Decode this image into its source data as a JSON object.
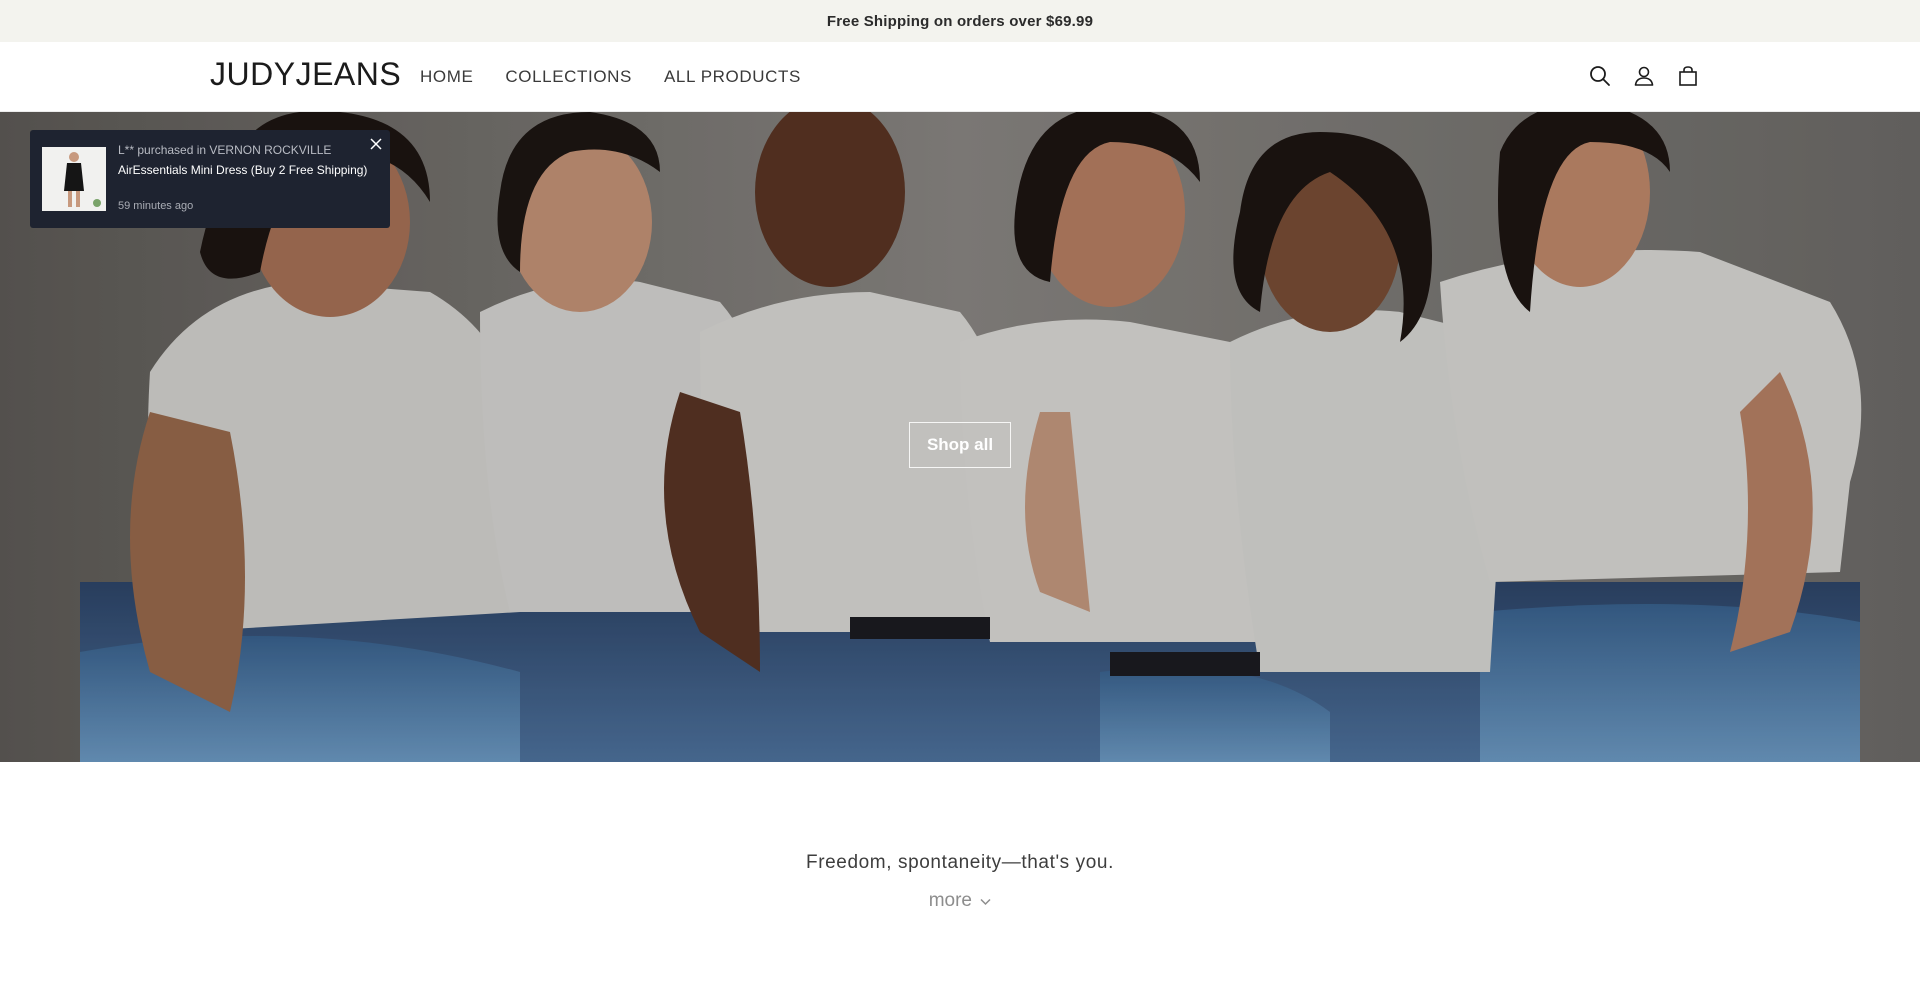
{
  "announcement": {
    "text": "Free Shipping on orders over $69.99"
  },
  "header": {
    "logo": "JUDYJEANS",
    "nav": [
      {
        "label": "HOME"
      },
      {
        "label": "COLLECTIONS"
      },
      {
        "label": "ALL PRODUCTS"
      }
    ],
    "icons": [
      "search-icon",
      "account-icon",
      "cart-icon"
    ]
  },
  "hero": {
    "button_label": "Shop all"
  },
  "toast": {
    "line1": "L** purchased in VERNON ROCKVILLE",
    "product": "AirEssentials Mini Dress (Buy 2 Free Shipping)",
    "time": "59 minutes ago"
  },
  "intro": {
    "tagline": "Freedom, spontaneity—that's you.",
    "more_label": "more"
  },
  "colors": {
    "announcement_bg": "#f3f3ee",
    "toast_bg": "#1e2330",
    "text_dark": "#222222"
  }
}
